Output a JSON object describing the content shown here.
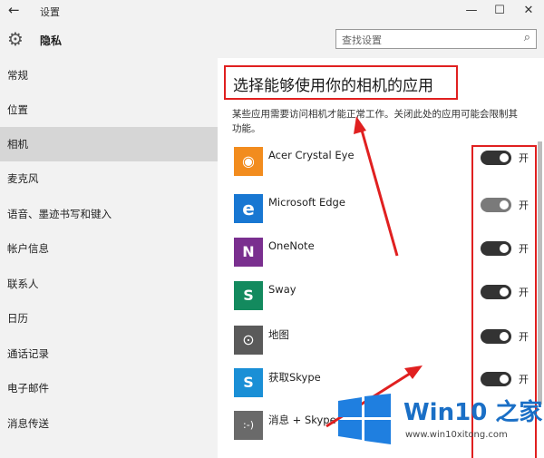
{
  "window": {
    "title": "设置",
    "back_glyph": "←",
    "minimize_glyph": "—",
    "maximize_glyph": "☐",
    "close_glyph": "✕"
  },
  "header": {
    "title": "隐私",
    "search_placeholder": "查找设置",
    "gear_glyph": "⚙",
    "search_glyph": "⌕"
  },
  "sidebar": {
    "active_index": 2,
    "items": [
      {
        "label": "常规"
      },
      {
        "label": "位置"
      },
      {
        "label": "相机"
      },
      {
        "label": "麦克风"
      },
      {
        "label": "语音、墨迹书写和键入"
      },
      {
        "label": "帐户信息"
      },
      {
        "label": "联系人"
      },
      {
        "label": "日历"
      },
      {
        "label": "通话记录"
      },
      {
        "label": "电子邮件"
      },
      {
        "label": "消息传送"
      }
    ]
  },
  "main": {
    "heading": "选择能够使用你的相机的应用",
    "description": "某些应用需要访问相机才能正常工作。关闭此处的应用可能会限制其功能。",
    "toggle_label": "开",
    "apps": [
      {
        "name": "Acer Crystal Eye",
        "icon": "camera-icon",
        "color": "#f28c1e",
        "glyph": "◉",
        "state": "on"
      },
      {
        "name": "Microsoft Edge",
        "icon": "edge-icon",
        "color": "#1877d2",
        "glyph": "e",
        "state": "on"
      },
      {
        "name": "OneNote",
        "icon": "onenote-icon",
        "color": "#7a2f8f",
        "glyph": "N",
        "state": "on"
      },
      {
        "name": "Sway",
        "icon": "sway-icon",
        "color": "#138a5e",
        "glyph": "S",
        "state": "on"
      },
      {
        "name": "地图",
        "icon": "maps-icon",
        "color": "#5a5a5a",
        "glyph": "⊙",
        "state": "on"
      },
      {
        "name": "获取Skype",
        "icon": "skype-icon",
        "color": "#1a8fd6",
        "glyph": "S",
        "state": "on"
      },
      {
        "name": "消息 + Skype",
        "icon": "messaging-icon",
        "color": "#6a6a6a",
        "glyph": ":-)",
        "state": "on"
      }
    ]
  },
  "watermark": {
    "brand": "Win10 之家",
    "url": "www.win10xitong.com"
  },
  "colors": {
    "annotation_red": "#e02020",
    "brand_blue": "#1a6fc6"
  }
}
